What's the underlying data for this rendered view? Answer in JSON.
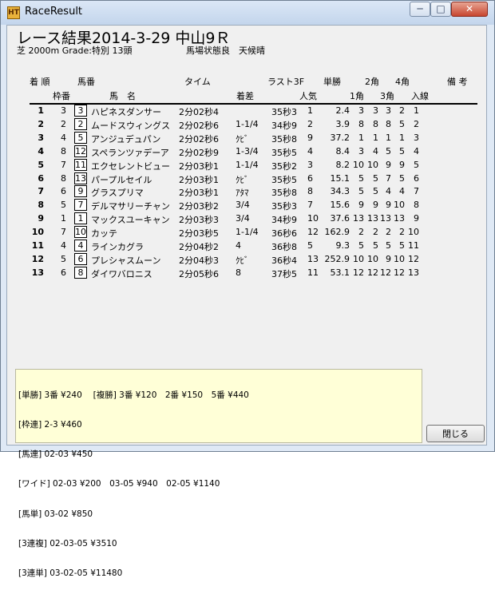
{
  "window": {
    "title": "RaceResult",
    "app_icon_label": "HT",
    "min_glyph": "─",
    "max_glyph": "□",
    "close_glyph": "✕"
  },
  "race": {
    "title": "レース結果2014-3-29 中山9Ｒ",
    "info": "芝 2000m Grade:特別 13頭",
    "conditions": "馬場状態良　天候晴"
  },
  "headers": {
    "row1": {
      "pos": "着 順",
      "num": "馬番",
      "time": "タイム",
      "last3f": "ラスト3F",
      "odds": "単勝",
      "c2": "2角",
      "c4": "4角",
      "remarks": "備 考"
    },
    "row2": {
      "frame": "枠番",
      "name": "馬　名",
      "margin": "着差",
      "pop": "人気",
      "c1": "1角",
      "c3": "3角",
      "finish": "入線"
    }
  },
  "results": [
    {
      "pos": "1",
      "frame": "3",
      "num": "3",
      "name": "ハピネスダンサー",
      "time": "2分02秒4",
      "margin": "",
      "last3f": "35秒3",
      "pop": "1",
      "odds": "2.4",
      "c1": "3",
      "c2": "3",
      "c3": "3",
      "c4": "2",
      "finish": "1"
    },
    {
      "pos": "2",
      "frame": "2",
      "num": "2",
      "name": "ムードスウィングス",
      "time": "2分02秒6",
      "margin": "1-1/4",
      "last3f": "34秒9",
      "pop": "2",
      "odds": "3.9",
      "c1": "8",
      "c2": "8",
      "c3": "8",
      "c4": "5",
      "finish": "2"
    },
    {
      "pos": "3",
      "frame": "4",
      "num": "5",
      "name": "アンジュデュパン",
      "time": "2分02秒6",
      "margin": "ｸﾋﾞ",
      "last3f": "35秒8",
      "pop": "9",
      "odds": "37.2",
      "c1": "1",
      "c2": "1",
      "c3": "1",
      "c4": "1",
      "finish": "3"
    },
    {
      "pos": "4",
      "frame": "8",
      "num": "12",
      "name": "スペランツァデーア",
      "time": "2分02秒9",
      "margin": "1-3/4",
      "last3f": "35秒5",
      "pop": "4",
      "odds": "8.4",
      "c1": "3",
      "c2": "4",
      "c3": "5",
      "c4": "5",
      "finish": "4"
    },
    {
      "pos": "5",
      "frame": "7",
      "num": "11",
      "name": "エクセレントビュー",
      "time": "2分03秒1",
      "margin": "1-1/4",
      "last3f": "35秒2",
      "pop": "3",
      "odds": "8.2",
      "c1": "10",
      "c2": "10",
      "c3": "9",
      "c4": "9",
      "finish": "5"
    },
    {
      "pos": "6",
      "frame": "8",
      "num": "13",
      "name": "パープルセイル",
      "time": "2分03秒1",
      "margin": "ｸﾋﾞ",
      "last3f": "35秒5",
      "pop": "6",
      "odds": "15.1",
      "c1": "5",
      "c2": "5",
      "c3": "7",
      "c4": "5",
      "finish": "6"
    },
    {
      "pos": "7",
      "frame": "6",
      "num": "9",
      "name": "グラスプリマ",
      "time": "2分03秒1",
      "margin": "ｱﾀﾏ",
      "last3f": "35秒8",
      "pop": "8",
      "odds": "34.3",
      "c1": "5",
      "c2": "5",
      "c3": "4",
      "c4": "4",
      "finish": "7"
    },
    {
      "pos": "8",
      "frame": "5",
      "num": "7",
      "name": "デルマサリーチャン",
      "time": "2分03秒2",
      "margin": "3/4",
      "last3f": "35秒3",
      "pop": "7",
      "odds": "15.6",
      "c1": "9",
      "c2": "9",
      "c3": "9",
      "c4": "10",
      "finish": "8"
    },
    {
      "pos": "9",
      "frame": "1",
      "num": "1",
      "name": "マックスユーキャン",
      "time": "2分03秒3",
      "margin": "3/4",
      "last3f": "34秒9",
      "pop": "10",
      "odds": "37.6",
      "c1": "13",
      "c2": "13",
      "c3": "13",
      "c4": "13",
      "finish": "9"
    },
    {
      "pos": "10",
      "frame": "7",
      "num": "10",
      "name": "カッテ",
      "time": "2分03秒5",
      "margin": "1-1/4",
      "last3f": "36秒6",
      "pop": "12",
      "odds": "162.9",
      "c1": "2",
      "c2": "2",
      "c3": "2",
      "c4": "2",
      "finish": "10"
    },
    {
      "pos": "11",
      "frame": "4",
      "num": "4",
      "name": "ラインカグラ",
      "time": "2分04秒2",
      "margin": "4",
      "last3f": "36秒8",
      "pop": "5",
      "odds": "9.3",
      "c1": "5",
      "c2": "5",
      "c3": "5",
      "c4": "5",
      "finish": "11"
    },
    {
      "pos": "12",
      "frame": "5",
      "num": "6",
      "name": "プレシャスムーン",
      "time": "2分04秒3",
      "margin": "ｸﾋﾞ",
      "last3f": "36秒4",
      "pop": "13",
      "odds": "252.9",
      "c1": "10",
      "c2": "10",
      "c3": "9",
      "c4": "10",
      "finish": "12"
    },
    {
      "pos": "13",
      "frame": "6",
      "num": "8",
      "name": "ダイワバロニス",
      "time": "2分05秒6",
      "margin": "8",
      "last3f": "37秒5",
      "pop": "11",
      "odds": "53.1",
      "c1": "12",
      "c2": "12",
      "c3": "12",
      "c4": "12",
      "finish": "13"
    }
  ],
  "payouts": [
    "[単勝] 3番 ¥240　 [複勝] 3番 ¥120　2番 ¥150　5番 ¥440",
    "[枠連] 2-3 ¥460",
    "[馬連] 02-03 ¥450",
    "[ワイド] 02-03 ¥200　03-05 ¥940　02-05 ¥1140",
    "[馬単] 03-02 ¥850",
    "[3連複] 02-03-05 ¥3510",
    "[3連単] 03-02-05 ¥11480"
  ],
  "buttons": {
    "close": "閉じる"
  }
}
